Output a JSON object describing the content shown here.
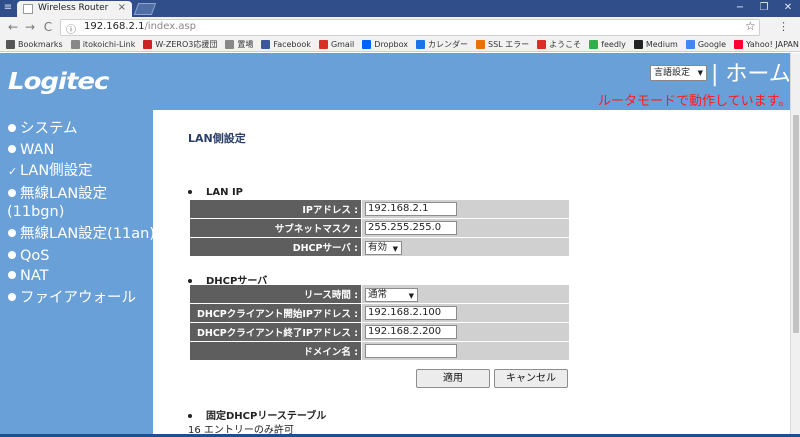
{
  "browser": {
    "tab_title": "Wireless Router",
    "tab_close": "×",
    "window_buttons": [
      "−",
      "❐",
      "✕"
    ],
    "nav": {
      "back": "←",
      "forward": "→",
      "reload": "C"
    },
    "address": {
      "info": "ⓘ",
      "host": "192.168.2.1",
      "path": "/index.asp"
    },
    "star": "☆",
    "menu": "⋮",
    "bookmarks": [
      {
        "label": "Bookmarks",
        "icon_color": "#555555"
      },
      {
        "label": "itokoichi-Link",
        "icon_color": "#888888"
      },
      {
        "label": "W-ZERO3応援団",
        "icon_color": "#cc2222"
      },
      {
        "label": "置場",
        "icon_color": "#888888"
      },
      {
        "label": "Facebook",
        "icon_color": "#3b5998"
      },
      {
        "label": "Gmail",
        "icon_color": "#d93025"
      },
      {
        "label": "Dropbox",
        "icon_color": "#0061fe"
      },
      {
        "label": "カレンダー",
        "icon_color": "#1a73e8"
      },
      {
        "label": "SSL エラー",
        "icon_color": "#e8710a"
      },
      {
        "label": "ようこそ",
        "icon_color": "#d93025"
      },
      {
        "label": "feedly",
        "icon_color": "#2bb24c"
      },
      {
        "label": "Medium",
        "icon_color": "#222222"
      },
      {
        "label": "Google",
        "icon_color": "#4285f4"
      },
      {
        "label": "Yahoo! JAPAN",
        "icon_color": "#ff0033"
      }
    ]
  },
  "header": {
    "logo": "Logitec",
    "lang_select": "言語設定",
    "home_link": "| ホーム |",
    "status": "ルータモードで動作しています。"
  },
  "sidebar": {
    "items": [
      {
        "label": "システム"
      },
      {
        "label": "WAN"
      },
      {
        "label": "LAN側設定",
        "check": "✓"
      },
      {
        "label": "無線LAN設定"
      },
      {
        "label": "(11bgn)"
      },
      {
        "label": "無線LAN設定(11an)"
      },
      {
        "label": "QoS"
      },
      {
        "label": "NAT"
      },
      {
        "label": "ファイアウォール"
      }
    ]
  },
  "main": {
    "title": "LAN側設定",
    "lan_ip": {
      "heading": "LAN IP",
      "ip_label": "IPアドレス :",
      "ip_value": "192.168.2.1",
      "mask_label": "サブネットマスク :",
      "mask_value": "255.255.255.0",
      "dhcp_label": "DHCPサーバ :",
      "dhcp_value": "有効"
    },
    "dhcp": {
      "heading": "DHCPサーバ",
      "lease_label": "リース時間 :",
      "lease_value": "通常",
      "start_label": "DHCPクライアント開始IPアドレス :",
      "start_value": "192.168.2.100",
      "end_label": "DHCPクライアント終了IPアドレス :",
      "end_value": "192.168.2.200",
      "domain_label": "ドメイン名 :",
      "domain_value": ""
    },
    "apply_label": "適用",
    "cancel_label": "キャンセル",
    "static_heading": "固定DHCPリーステーブル",
    "static_note": "16 エントリーのみ許可"
  }
}
